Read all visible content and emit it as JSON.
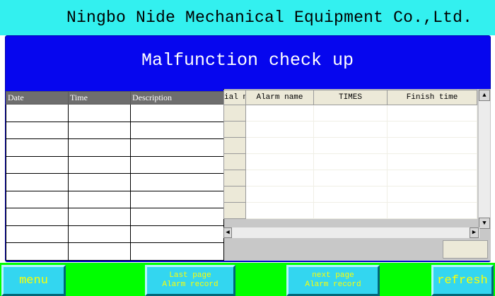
{
  "header": {
    "company": "Ningbo Nide Mechanical Equipment Co.,Ltd."
  },
  "screen": {
    "title": "Malfunction check up"
  },
  "history_table": {
    "columns": [
      "Date",
      "Time",
      "Description"
    ],
    "row_count": 9
  },
  "alarm_grid": {
    "columns": [
      "Serial number",
      "Alarm name",
      "TIMES",
      "Finish time"
    ],
    "visible_serial_header": "ial n",
    "row_count": 7
  },
  "buttons": {
    "menu": "menu",
    "last_page_line1": "Last page",
    "last_page_line2": "Alarm record",
    "next_page_line1": "next page",
    "next_page_line2": "Alarm record",
    "refresh": "refresh"
  },
  "colors": {
    "header": "#33f0ef",
    "panel": "#0606ee",
    "bottom_bar": "#00ff00",
    "button": "#33d6f0",
    "button_text": "#ffff00"
  }
}
